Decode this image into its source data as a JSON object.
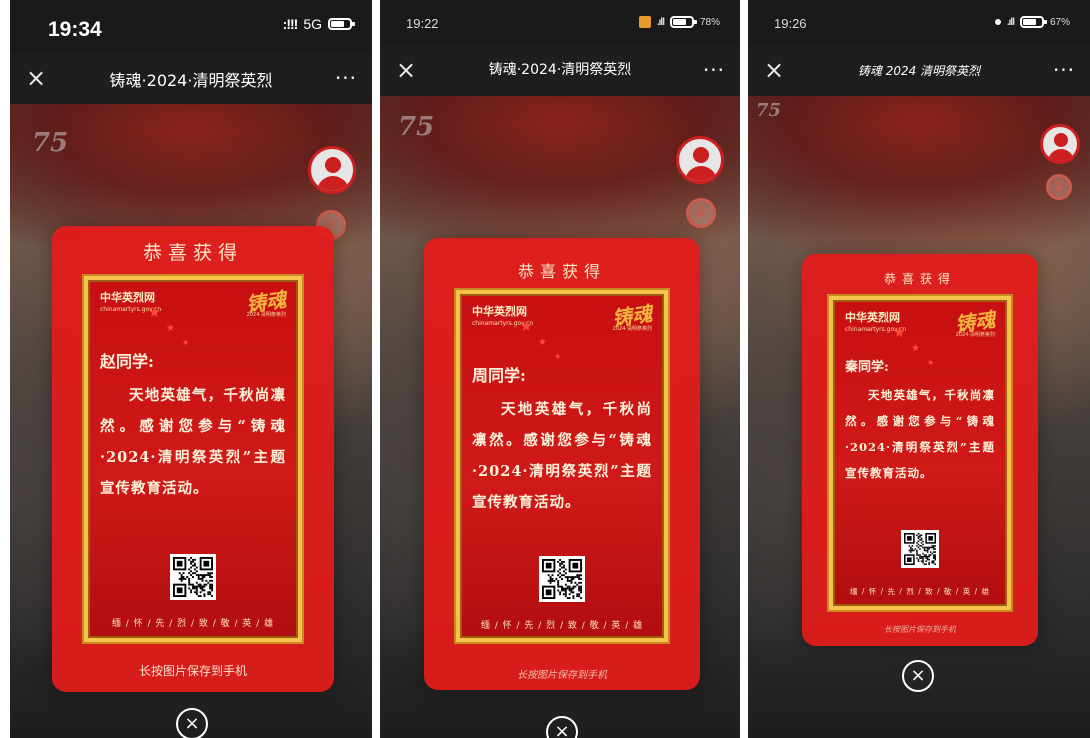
{
  "screens": [
    {
      "status_time": "19:34",
      "status_network": "5G",
      "status_battery": "",
      "nav_title": "铸魂·2024·清明祭英烈",
      "modal_heading": "恭喜获得",
      "greeting": "赵同学:",
      "hint": "长按图片保存到手机"
    },
    {
      "status_time": "19:22",
      "status_network": "",
      "status_battery": "78%",
      "nav_title": "铸魂·2024·清明祭英烈",
      "modal_heading": "恭喜获得",
      "greeting": "周同学:",
      "hint": "长按图片保存到手机"
    },
    {
      "status_time": "19:26",
      "status_network": "",
      "status_battery": "67%",
      "nav_title": "铸魂 2024 清明祭英烈",
      "modal_heading": "恭喜获得",
      "greeting": "秦同学:",
      "hint": "长按图片保存到手机"
    }
  ],
  "nav": {
    "close_symbol": "×",
    "more_symbol": "···"
  },
  "background_badge": "75",
  "card": {
    "site_name": "中华英烈网",
    "site_url": "chinamartyrs.gov.cn",
    "logo_text": "铸魂",
    "logo_sub": "2024·清明祭英烈",
    "message": "天地英雄气，千秋尚凛然。感谢您参与“铸魂·2024·清明祭英烈”主题宣传教育活动。",
    "slogan": "缅 / 怀 / 先 / 烈 / 致 / 敬 / 英 / 雄"
  },
  "close_button_symbol": "×",
  "icons": [
    "close-icon",
    "more-icon",
    "avatar-icon",
    "medal-icon",
    "qr-code",
    "close-circle-icon",
    "battery-icon",
    "signal-icon"
  ],
  "colors": {
    "modal_red": "#e21c1c",
    "card_red": "#c80f12",
    "gold_frame": "#f5c24a",
    "heading_cream": "#ffe9c8",
    "nav_bg": "#1e1e1e"
  }
}
